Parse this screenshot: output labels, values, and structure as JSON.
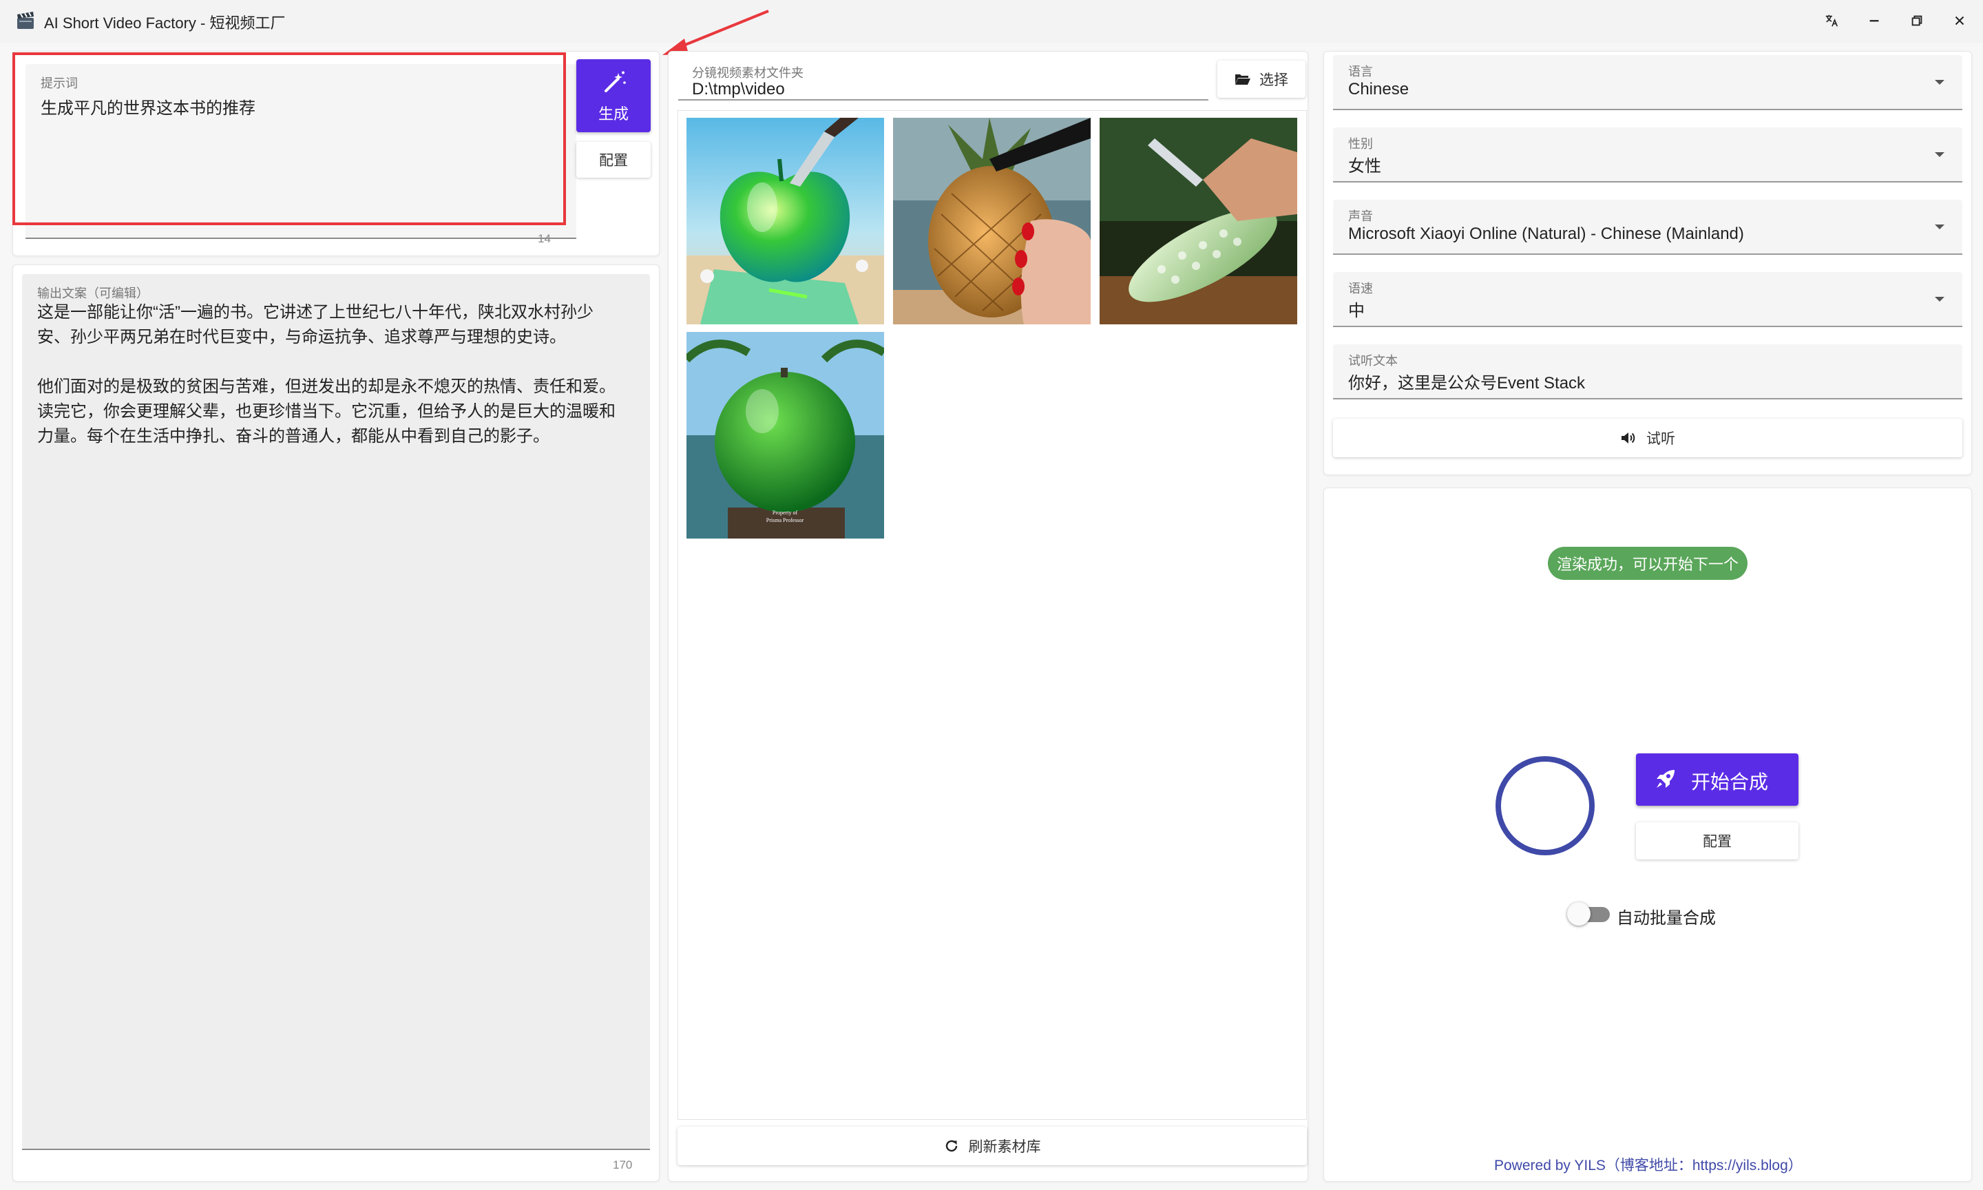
{
  "window": {
    "title": "AI Short Video Factory - 短视频工厂",
    "icons": [
      "clapperboard-icon",
      "translate-icon",
      "minimize-icon",
      "restore-icon",
      "close-icon"
    ]
  },
  "prompt": {
    "label": "提示词",
    "value": "生成平凡的世界这本书的推荐",
    "count": "14",
    "generate_label": "生成",
    "config_label": "配置"
  },
  "output": {
    "label": "输出文案（可编辑）",
    "value": "这是一部能让你“活”一遍的书。它讲述了上世纪七八十年代，陕北双水村孙少\n安、孙少平两兄弟在时代巨变中，与命运抗争、追求尊严与理想的史诗。\n\n他们面对的是极致的贫困与苦难，但迸发出的却是永不熄灭的热情、责任和爱。\n读完它，你会更理解父辈，也更珍惜当下。它沉重，但给予人的是巨大的温暖和\n力量。每个在生活中挣扎、奋斗的普通人，都能从中看到自己的影子。",
    "count": "170"
  },
  "materials": {
    "folder_label": "分镜视频素材文件夹",
    "folder_value": "D:\\tmp\\video",
    "select_label": "选择",
    "refresh_label": "刷新素材库",
    "watermark": "Property of Prisma Professor",
    "thumbnails": [
      {
        "name": "glass-apple"
      },
      {
        "name": "glass-pineapple"
      },
      {
        "name": "glass-cucumber"
      },
      {
        "name": "green-coconut"
      }
    ]
  },
  "tts": {
    "language": {
      "label": "语言",
      "value": "Chinese"
    },
    "gender": {
      "label": "性别",
      "value": "女性"
    },
    "voice": {
      "label": "声音",
      "value": "Microsoft Xiaoyi Online (Natural) - Chinese (Mainland)"
    },
    "speed": {
      "label": "语速",
      "value": "中"
    },
    "preview_text": {
      "label": "试听文本",
      "value": "你好，这里是公众号Event Stack"
    },
    "preview_button": "试听"
  },
  "render": {
    "toast": "渲染成功，可以开始下一个",
    "start_label": "开始合成",
    "config_label": "配置",
    "auto_batch_label": "自动批量合成",
    "auto_batch_on": false,
    "footer": "Powered by YILS（博客地址：https://yils.blog）"
  },
  "colors": {
    "accent": "#5b2ce6",
    "success": "#5aa65a",
    "spinner": "#3f49a8",
    "highlight": "#e8383d"
  }
}
